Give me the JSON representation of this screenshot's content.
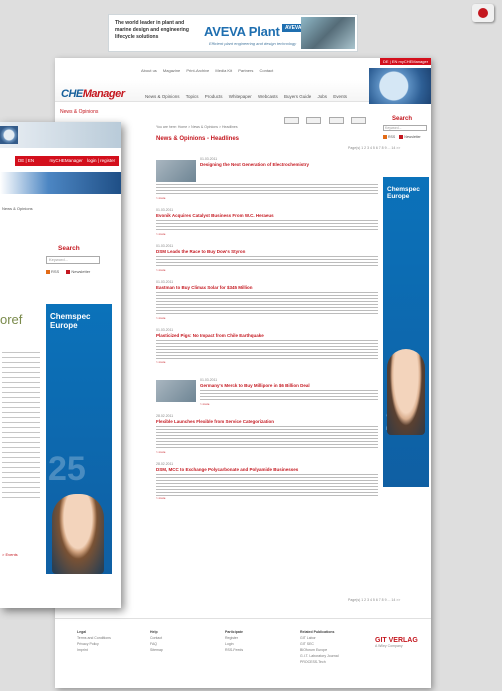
{
  "ad_banner": {
    "headline": "The world leader in plant and marine design and engineering lifecycle solutions",
    "brand": "AVEVA Plant",
    "brand_mark": "AVEVA",
    "tagline": "Efficient plant engineering and design technology"
  },
  "header": {
    "lang": "DE | EN",
    "login": "myCHEManager",
    "top_nav": [
      "About us",
      "Magazine",
      "Print-Archive",
      "Media Kit",
      "Partners",
      "Contact"
    ],
    "logo_main": "CHE",
    "logo_accent": "Manager",
    "main_nav": [
      "News & Opinions",
      "Topics",
      "Products",
      "Whitepaper",
      "Webcasts",
      "Buyers Guide",
      "Jobs",
      "Events"
    ],
    "sidebar_label": "News & Opinions"
  },
  "content": {
    "breadcrumb": "You are here: Home > News & Opinions > Headlines",
    "section_title": "News & Opinions - Headlines",
    "pagination": "Page(s) 1 2 3 4 5 6 7 8 9 ... 14 >>",
    "articles": [
      {
        "date": "01.03.2011",
        "title": "Designing the Next Generation of Electrochemistry"
      },
      {
        "date": "01.03.2011",
        "title": "Evonik Acquires Catalyst Business From W.C. Heraeus"
      },
      {
        "date": "01.03.2011",
        "title": "DSM Leads the Race to Buy Dow's Styron"
      },
      {
        "date": "01.03.2011",
        "title": "Eastman to Buy Climax Solar for $345 Million"
      },
      {
        "date": "01.03.2011",
        "title": "Plasticized Pigs: No Impact from Chile Earthquake"
      },
      {
        "date": "01.03.2011",
        "title": "Germany's Merck to Buy Millipore in $6 Billion Deal"
      },
      {
        "date": "28.02.2011",
        "title": "Flexible Launches Flexible from Service Categorization"
      },
      {
        "date": "28.02.2011",
        "title": "DSM, MCC to Exchange Polycarbonate and Polyamide Businesses"
      }
    ],
    "more": "> more"
  },
  "sidebar": {
    "search_label": "Search",
    "search_placeholder": "Keyword...",
    "rss": "RSS",
    "newsletter": "Newsletter",
    "ad_brand": "Chemspec Europe",
    "ad_number": "25"
  },
  "footer": {
    "columns": [
      {
        "heading": "Legal",
        "links": [
          "Terms and Conditions",
          "Privacy Policy",
          "Imprint"
        ]
      },
      {
        "heading": "Help",
        "links": [
          "Contact",
          "FAQ",
          "Sitemap"
        ]
      },
      {
        "heading": "Participate",
        "links": [
          "Register",
          "Login",
          "RSS-Feeds"
        ]
      },
      {
        "heading": "Related Publications",
        "links": [
          "GIT Labor",
          "GIT SEC",
          "BIOforum Europe",
          "G.I.T. Laboratory Journal",
          "PROCESS-Tech"
        ]
      }
    ],
    "brand": "GIT VERLAG",
    "brand_sub": "A Wiley Company"
  },
  "overlay": {
    "lang": "DE | EN",
    "login": "myCHEManager",
    "login_sub": "login | register",
    "side_label": "News & Opinions",
    "search_label": "Search",
    "search_placeholder": "Keyword...",
    "rss": "RSS",
    "newsletter": "Newsletter",
    "ad_brand": "Chemspec Europe",
    "ad_number": "25",
    "partial_word": "oref",
    "bottom_link": "> Events"
  }
}
